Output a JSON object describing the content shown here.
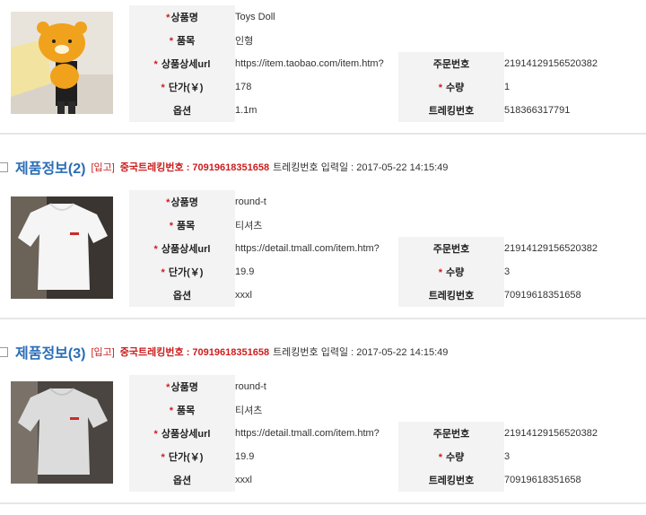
{
  "labels": {
    "name": "상품명",
    "category": "품목",
    "url": "상품상세url",
    "price": "단가(￥)",
    "option": "옵션",
    "order_no": "주문번호",
    "qty": "수량",
    "tracking_no": "트레킹번호",
    "required_mark": "*"
  },
  "products": [
    {
      "header": null,
      "name": "Toys Doll",
      "category": "인형",
      "url": "https://item.taobao.com/item.htm?",
      "price": "178",
      "option": "1.1m",
      "order_no": "21914129156520382",
      "qty": "1",
      "tracking_no": "518366317791",
      "image": "bear-doll-photo"
    },
    {
      "header": {
        "title": "제품정보(2)",
        "status_tag": "[입고]",
        "cn_tracking": "중국트레킹번호 : 70919618351658",
        "date_text": "트레킹번호 입력일 : 2017-05-22 14:15:49"
      },
      "name": "round-t",
      "category": "티셔츠",
      "url": "https://detail.tmall.com/item.htm?",
      "price": "19.9",
      "option": "xxxl",
      "order_no": "21914129156520382",
      "qty": "3",
      "tracking_no": "70919618351658",
      "image": "white-tshirt-photo"
    },
    {
      "header": {
        "title": "제품정보(3)",
        "status_tag": "[입고]",
        "cn_tracking": "중국트레킹번호 : 70919618351658",
        "date_text": "트레킹번호 입력일 : 2017-05-22 14:15:49"
      },
      "name": "round-t",
      "category": "티셔츠",
      "url": "https://detail.tmall.com/item.htm?",
      "price": "19.9",
      "option": "xxxl",
      "order_no": "21914129156520382",
      "qty": "3",
      "tracking_no": "70919618351658",
      "image": "grey-tshirt-photo"
    }
  ],
  "colors": {
    "title_blue": "#2a6db6",
    "required_red": "#cc1e1e",
    "label_bg": "#f3f3f3"
  }
}
